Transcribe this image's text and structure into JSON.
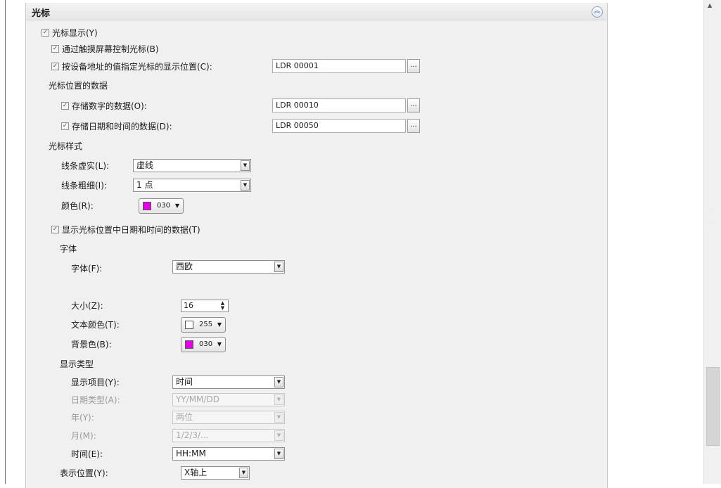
{
  "section": {
    "title": "光标"
  },
  "cursor_display": {
    "label": "光标显示(Y)",
    "checked": true
  },
  "touch_control": {
    "label": "通过触摸屏幕控制光标(B)",
    "checked": true
  },
  "position_by_device": {
    "label": "按设备地址的值指定光标的显示位置(C):",
    "checked": true,
    "value": "LDR 00001",
    "button": "..."
  },
  "position_data": {
    "heading": "光标位置的数据",
    "store_number": {
      "label": "存储数字的数据(O):",
      "checked": true,
      "value": "LDR 00010",
      "button": "..."
    },
    "store_datetime": {
      "label": "存储日期和时间的数据(D):",
      "checked": true,
      "value": "LDR 00050",
      "button": "..."
    }
  },
  "cursor_style": {
    "heading": "光标样式",
    "line_type": {
      "label": "线条虚实(L):",
      "value": "虚线"
    },
    "line_width": {
      "label": "线条粗细(I):",
      "value": "1 点"
    },
    "color": {
      "label": "颜色(R):",
      "value": "030",
      "swatch": "#e600e6"
    }
  },
  "show_datetime": {
    "label": "显示光标位置中日期和时间的数据(T)",
    "checked": true
  },
  "font": {
    "heading": "字体",
    "family": {
      "label": "字体(F):",
      "value": "西欧"
    },
    "size": {
      "label": "大小(Z):",
      "value": "16"
    },
    "text_color": {
      "label": "文本颜色(T):",
      "value": "255",
      "swatch": "#ffffff"
    },
    "bg_color": {
      "label": "背景色(B):",
      "value": "030",
      "swatch": "#e600e6"
    }
  },
  "display_type": {
    "heading": "显示类型",
    "item": {
      "label": "显示项目(Y):",
      "value": "时间",
      "enabled": true
    },
    "date_type": {
      "label": "日期类型(A):",
      "value": "YY/MM/DD",
      "enabled": false
    },
    "year": {
      "label": "年(Y):",
      "value": "两位",
      "enabled": false
    },
    "month": {
      "label": "月(M):",
      "value": "1/2/3/...",
      "enabled": false
    },
    "time": {
      "label": "时间(E):",
      "value": "HH:MM",
      "enabled": true
    }
  },
  "display_position": {
    "label": "表示位置(Y):",
    "value": "X轴上"
  },
  "icons": {
    "checkbox": "checkmark",
    "dropdown": "down-triangle",
    "collapse": "double-chevron-up",
    "scroll_up": "up-triangle"
  }
}
